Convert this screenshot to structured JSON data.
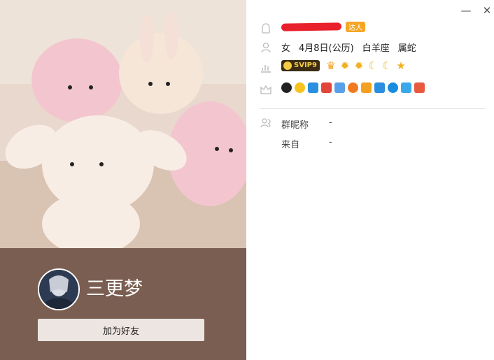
{
  "window": {
    "minimize_glyph": "—",
    "close_glyph": "✕"
  },
  "profile": {
    "nickname": "三更梦",
    "add_friend_label": "加为好友"
  },
  "info": {
    "expert_badge": "达人",
    "gender": "女",
    "birthday": "4月8日(公历)",
    "zodiac": "白羊座",
    "chinese_zodiac": "属蛇",
    "vip_label": "SVIP9",
    "level_icons": [
      "crown",
      "sun",
      "sun",
      "moon",
      "moon",
      "star"
    ],
    "service_icons": [
      "qq-penguin-icon",
      "star-icon",
      "camera-icon",
      "video-icon",
      "mail-icon",
      "music-icon",
      "shield-icon",
      "phone-icon",
      "search-icon",
      "cloud-icon",
      "game-icon"
    ]
  },
  "fields": [
    {
      "label": "群昵称",
      "value": "-"
    },
    {
      "label": "来自",
      "value": "-"
    }
  ],
  "colors": {
    "left_panel": "#7a5e51",
    "button_bg": "#ece5e2",
    "redaction": "#e8212c",
    "vip_bg": "#3a2b12",
    "vip_text": "#f5cc43"
  }
}
